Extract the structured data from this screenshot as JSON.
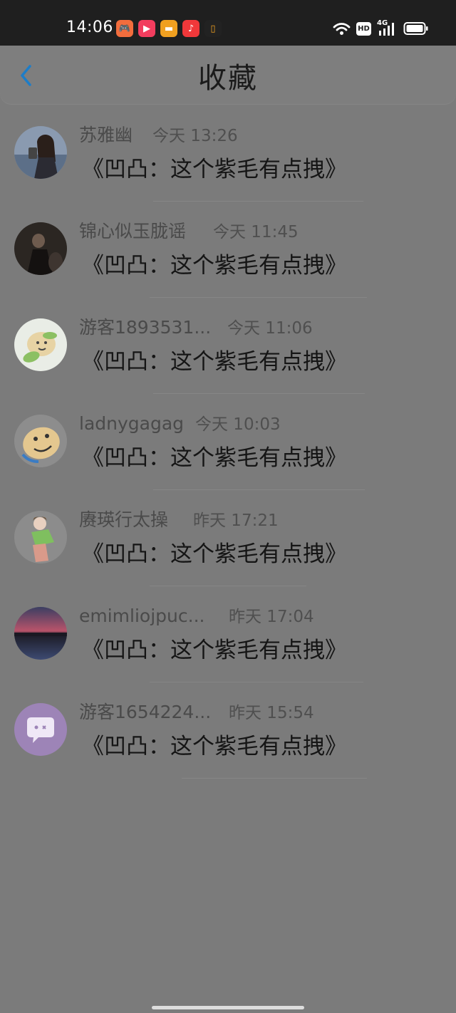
{
  "status_bar": {
    "time": "14:06",
    "apps": [
      {
        "icon": "game-app-icon",
        "glyph": "🎮",
        "color": "#f26d3d"
      },
      {
        "icon": "video-play-app-icon",
        "glyph": "▶",
        "color": "#f23d5e"
      },
      {
        "icon": "wallet-app-icon",
        "glyph": "▬",
        "color": "#f0a020"
      },
      {
        "icon": "music-app-icon",
        "glyph": "♪",
        "color": "#f0383a"
      },
      {
        "icon": "notes-app-icon",
        "glyph": "▯",
        "color": "#222222"
      }
    ],
    "hd_label": "HD",
    "network_label": "4G"
  },
  "header": {
    "title": "收藏",
    "back_icon": "chevron-left-icon",
    "accent": "#1d7dc8"
  },
  "favorites": [
    {
      "name": "苏雅幽",
      "time": "今天 13:26",
      "title": "《凹凸：这个紫毛有点拽》",
      "avatar": "woman-portrait"
    },
    {
      "name": "锦心似玉胧谣",
      "time": "今天 11:45",
      "title": "《凹凸：这个紫毛有点拽》",
      "avatar": "dark-photo"
    },
    {
      "name": "游客1893531...",
      "time": "今天 11:06",
      "title": "《凹凸：这个紫毛有点拽》",
      "avatar": "cartoon-plant"
    },
    {
      "name": "ladnygagag",
      "time": "今天 10:03",
      "title": "《凹凸：这个紫毛有点拽》",
      "avatar": "cartoon-face"
    },
    {
      "name": "赓瑛行太操",
      "time": "昨天 17:21",
      "title": "《凹凸：这个紫毛有点拽》",
      "avatar": "anime-character"
    },
    {
      "name": "emimliojpuc...",
      "time": "昨天 17:04",
      "title": "《凹凸：这个紫毛有点拽》",
      "avatar": "sunset-lake"
    },
    {
      "name": "游客1654224...",
      "time": "昨天 15:54",
      "title": "《凹凸：这个紫毛有点拽》",
      "avatar": "default-chat"
    }
  ]
}
